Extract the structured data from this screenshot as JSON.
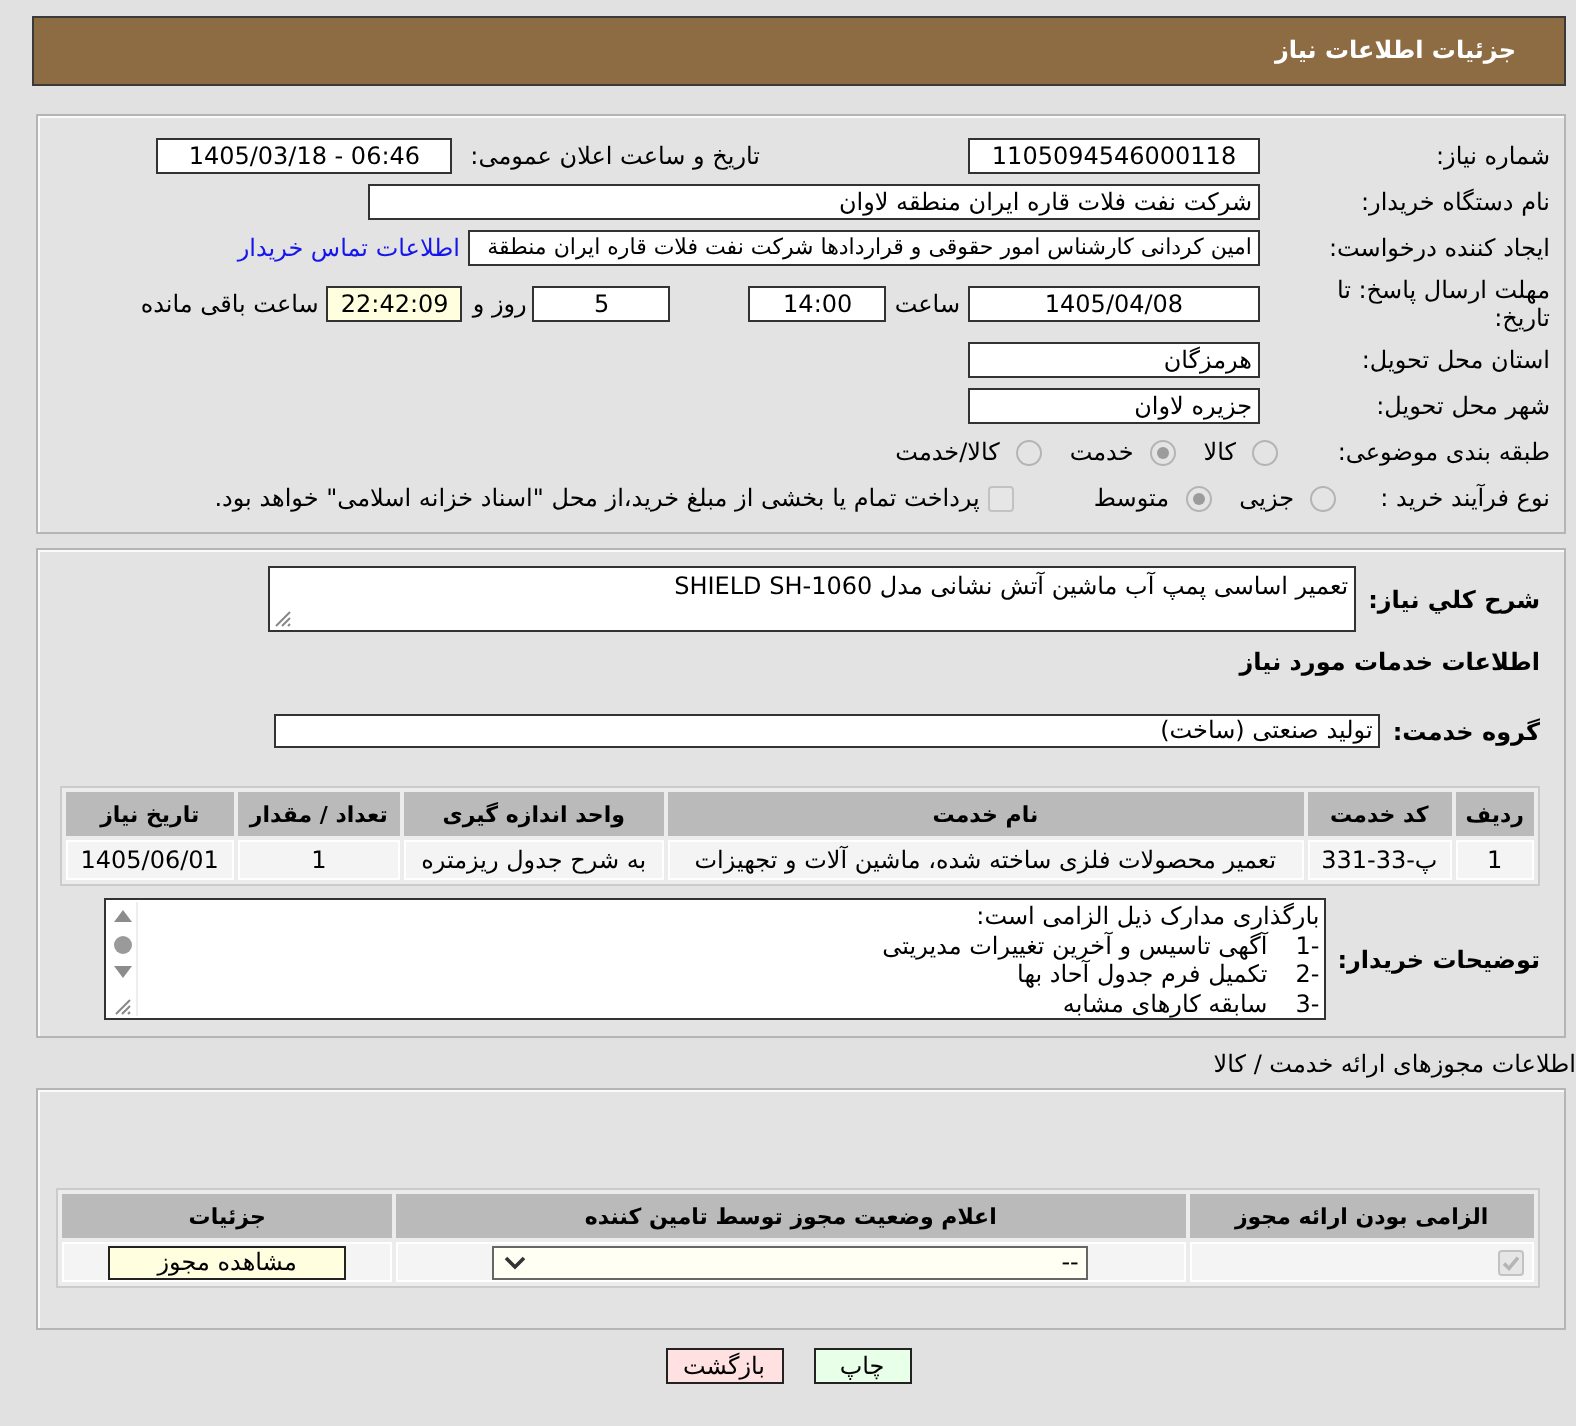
{
  "header": {
    "title": "جزئیات اطلاعات نیاز"
  },
  "details": {
    "need_number": {
      "label": "شماره نیاز:",
      "value": "1105094546000118"
    },
    "announce": {
      "label": "تاریخ و ساعت اعلان عمومی:",
      "value": "1405/03/18 - 06:46"
    },
    "buyer_org": {
      "label": "نام دستگاه خریدار:",
      "value": "شرکت نفت فلات قاره ایران منطقه لاوان"
    },
    "requester": {
      "label": "ایجاد کننده درخواست:",
      "value": "امین کردانی کارشناس امور حقوقی و قراردادها شرکت نفت فلات قاره ایران منطقة",
      "link": "اطلاعات تماس خریدار"
    },
    "deadline": {
      "label": "مهلت ارسال پاسخ: تا تاریخ:",
      "date": "1405/04/08",
      "time_label": "ساعت",
      "time": "14:00",
      "days": "5",
      "days_label": "روز و",
      "remaining": "22:42:09",
      "remaining_label": "ساعت باقی مانده"
    },
    "province": {
      "label": "استان محل تحویل:",
      "value": "هرمزگان"
    },
    "city": {
      "label": "شهر محل تحویل:",
      "value": "جزیره لاوان"
    },
    "category": {
      "label": "طبقه بندی موضوعی:",
      "disabled": true,
      "options": [
        {
          "label": "کالا",
          "selected": false
        },
        {
          "label": "خدمت",
          "selected": true
        },
        {
          "label": "کالا/خدمت",
          "selected": false
        }
      ]
    },
    "purchase_type": {
      "label": "نوع فرآیند خرید :",
      "disabled": true,
      "options": [
        {
          "label": "جزیی",
          "selected": false
        },
        {
          "label": "متوسط",
          "selected": true
        }
      ],
      "treasury": {
        "checked": false,
        "disabled": true,
        "label": "پرداخت تمام یا بخشی از مبلغ خرید،از محل \"اسناد خزانه اسلامی\" خواهد بود."
      }
    }
  },
  "need": {
    "description_label": "شرح كلي نياز:",
    "description": "تعمیر اساسی پمپ آب ماشین آتش نشانی مدل SHIELD SH-1060",
    "services_title": "اطلاعات خدمات مورد نیاز",
    "group_label": "گروه خدمت:",
    "group": "تولید صنعتی (ساخت)",
    "table": {
      "columns": [
        "ردیف",
        "کد خدمت",
        "نام خدمت",
        "واحد اندازه گیری",
        "تعداد / مقدار",
        "تاریخ نیاز"
      ],
      "rows": [
        [
          "1",
          "پ-33-331",
          "تعمیر محصولات فلزی ساخته شده، ماشین آلات و تجهیزات",
          "به شرح جدول ریزمتره",
          "1",
          "1405/06/01"
        ]
      ]
    },
    "notes_label": "توضیحات خریدار:",
    "notes": {
      "intro": "بارگذاری مدارک ذیل الزامی است:",
      "items": [
        {
          "number": "1-",
          "text": "آگهی تاسیس و آخرین تغییرات مدیریتی"
        },
        {
          "number": "2-",
          "text": "تکمیل فرم جدول آحاد بها"
        },
        {
          "number": "3-",
          "text": "سابقه کارهای مشابه"
        }
      ]
    }
  },
  "licenses": {
    "title": "اطلاعات مجوزهای ارائه خدمت / کالا",
    "columns": [
      "الزامی بودن ارائه مجوز",
      "اعلام وضعیت مجوز توسط تامین کننده",
      "جزئیات"
    ],
    "rows": [
      {
        "required": {
          "checked": true,
          "disabled": true
        },
        "status": "--",
        "action": "مشاهده مجوز"
      }
    ]
  },
  "buttons": [
    {
      "label": "چاپ",
      "kind": "print"
    },
    {
      "label": "بازگشت",
      "kind": "back"
    }
  ]
}
